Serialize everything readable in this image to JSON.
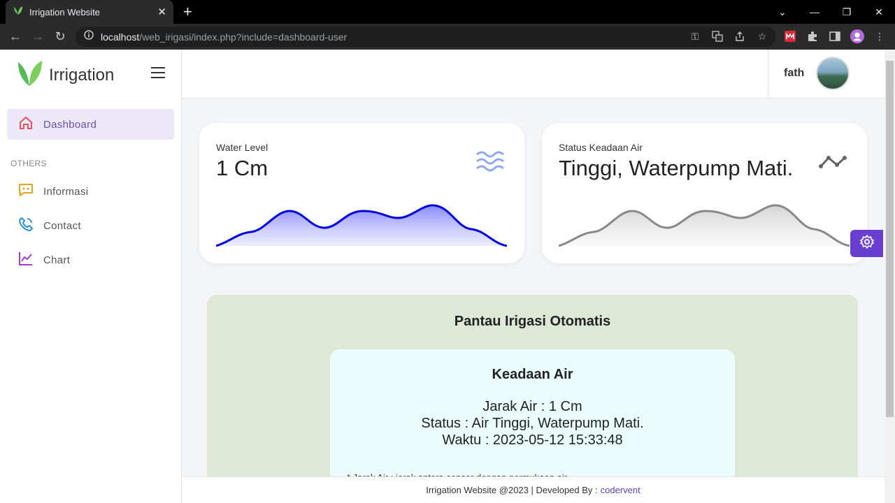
{
  "browser": {
    "tab_title": "Irrigation Website",
    "tab_close": "✕",
    "new_tab": "+",
    "url_host": "localhost",
    "url_path": "/web_irigasi/index.php?include=dashboard-user"
  },
  "sidebar": {
    "brand": "Irrigation",
    "active_item": {
      "label": "Dashboard",
      "icon": "home-icon"
    },
    "section_label": "OTHERS",
    "items": [
      {
        "label": "Informasi",
        "icon": "chat-icon"
      },
      {
        "label": "Contact",
        "icon": "phone-icon"
      },
      {
        "label": "Chart",
        "icon": "chart-icon"
      }
    ]
  },
  "topbar": {
    "username": "fath"
  },
  "cards": [
    {
      "label": "Water Level",
      "value": "1 Cm",
      "icon": "waves-icon",
      "color": "#0000dd"
    },
    {
      "label": "Status Keadaan Air",
      "value": "Tinggi, Waterpump Mati.",
      "icon": "activity-icon",
      "color": "#888888"
    }
  ],
  "monitor": {
    "title": "Pantau Irigasi Otomatis",
    "box_title": "Keadaan Air",
    "jarak": "Jarak Air : 1 Cm",
    "status": "Status : Air Tinggi, Waterpump Mati.",
    "waktu": "Waktu : 2023-05-12 15:33:48",
    "note": "* Jarak Air : jarak antara sensor dengan permukaan air"
  },
  "footer": {
    "text": "Irrigation Website @2023 | Developed By :",
    "link": "codervent"
  },
  "colors": {
    "accent": "#6a3fd0",
    "monitor_bg": "#dde9d6",
    "status_bg": "#eafdfc"
  }
}
